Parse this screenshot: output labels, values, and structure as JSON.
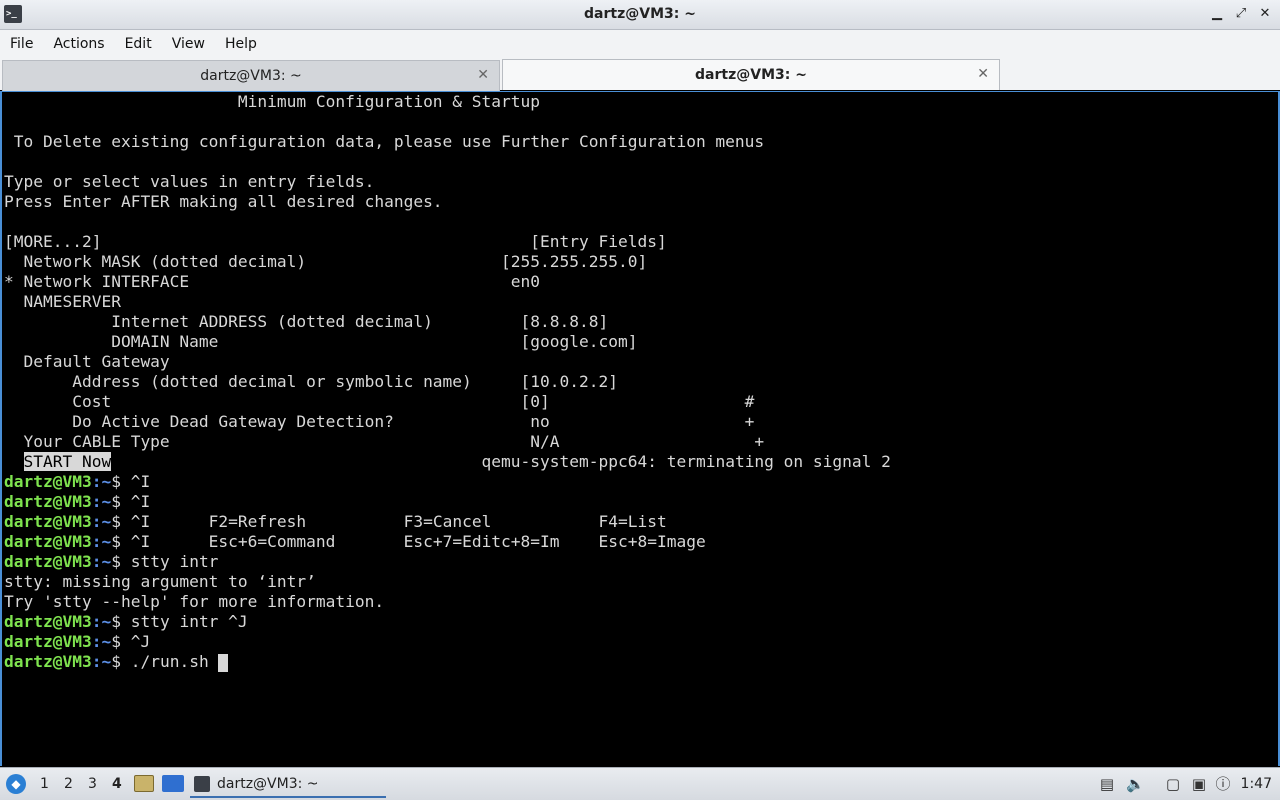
{
  "window": {
    "title": "dartz@VM3: ~",
    "minimize": "▁",
    "maximize": "⤢",
    "close": "✕"
  },
  "menu": {
    "items": [
      "File",
      "Actions",
      "Edit",
      "View",
      "Help"
    ]
  },
  "tabs": [
    {
      "label": "dartz@VM3: ~",
      "active": false
    },
    {
      "label": "dartz@VM3: ~",
      "active": true
    }
  ],
  "terminal": {
    "lines": [
      "                        Minimum Configuration & Startup",
      "",
      " To Delete existing configuration data, please use Further Configuration menus",
      "",
      "Type or select values in entry fields.",
      "Press Enter AFTER making all desired changes.",
      "",
      "[MORE...2]                                            [Entry Fields]",
      "  Network MASK (dotted decimal)                    [255.255.255.0]",
      "* Network INTERFACE                                 en0",
      "  NAMESERVER",
      "           Internet ADDRESS (dotted decimal)         [8.8.8.8]",
      "           DOMAIN Name                               [google.com]",
      "  Default Gateway",
      "       Address (dotted decimal or symbolic name)     [10.0.2.2]",
      "       Cost                                          [0]                    #",
      "       Do Active Dead Gateway Detection?              no                    +",
      "  Your CABLE Type                                     N/A                    +"
    ],
    "start_now": "START Now",
    "start_now_rest": "                                      qemu-system-ppc64: terminating on signal 2",
    "prompt_user": "dartz@VM3",
    "prompt_path": ":~",
    "prompt_sym": "$ ",
    "history": [
      {
        "type": "cmd",
        "text": "^I"
      },
      {
        "type": "cmd",
        "text": "^I"
      },
      {
        "type": "cmd",
        "text": "^I      F2=Refresh          F3=Cancel           F4=List"
      },
      {
        "type": "cmd",
        "text": "^I      Esc+6=Command       Esc+7=Editc+8=Im    Esc+8=Image"
      },
      {
        "type": "cmd",
        "text": "stty intr"
      },
      {
        "type": "out",
        "text": "stty: missing argument to ‘intr’"
      },
      {
        "type": "out",
        "text": "Try 'stty --help' for more information."
      },
      {
        "type": "cmd",
        "text": "stty intr ^J"
      },
      {
        "type": "cmd",
        "text": "^J"
      },
      {
        "type": "cmd",
        "text": "./run.sh "
      }
    ]
  },
  "taskbar": {
    "desktops": [
      "1",
      "2",
      "3",
      "4"
    ],
    "current_desktop": "4",
    "task_label": "dartz@VM3: ~",
    "clock": "1:47"
  }
}
